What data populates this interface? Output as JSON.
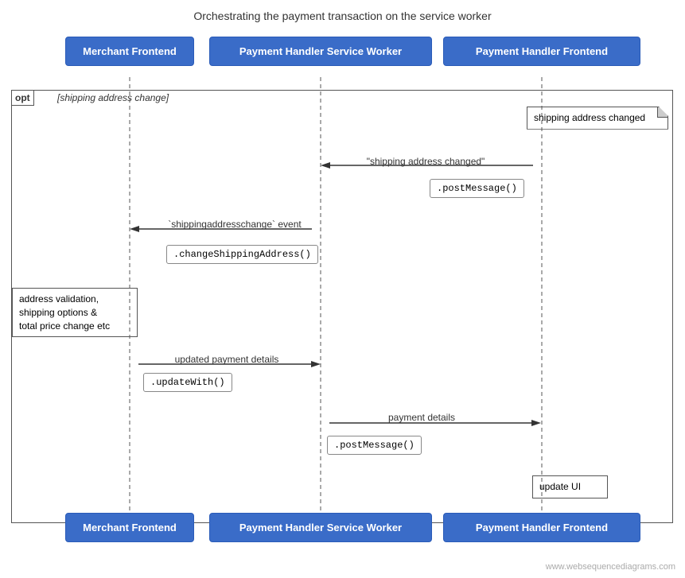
{
  "title": "Orchestrating the payment transaction on the service worker",
  "actors": {
    "merchant": "Merchant Frontend",
    "serviceWorker": "Payment Handler Service Worker",
    "paymentFrontend": "Payment Handler Frontend"
  },
  "opt": {
    "label": "opt",
    "guard": "[shipping address change]"
  },
  "notes": {
    "shippingAddressChanged": "shipping address changed",
    "addressValidation": "address validation,\nshipping options &\ntotal price change etc",
    "updateUI": "update UI"
  },
  "arrows": [
    {
      "id": "a1",
      "label": "\"shipping address changed\""
    },
    {
      "id": "a2",
      "label": "`.postMessage()`"
    },
    {
      "id": "a3",
      "label": "`shippingaddresschange` event"
    },
    {
      "id": "a4",
      "label": "`.changeShippingAddress()`"
    },
    {
      "id": "a5",
      "label": "updated payment details"
    },
    {
      "id": "a6",
      "label": "`.updateWith()`"
    },
    {
      "id": "a7",
      "label": "payment details"
    },
    {
      "id": "a8",
      "label": "`.postMessage()`"
    }
  ],
  "watermark": "www.websequencediagrams.com"
}
